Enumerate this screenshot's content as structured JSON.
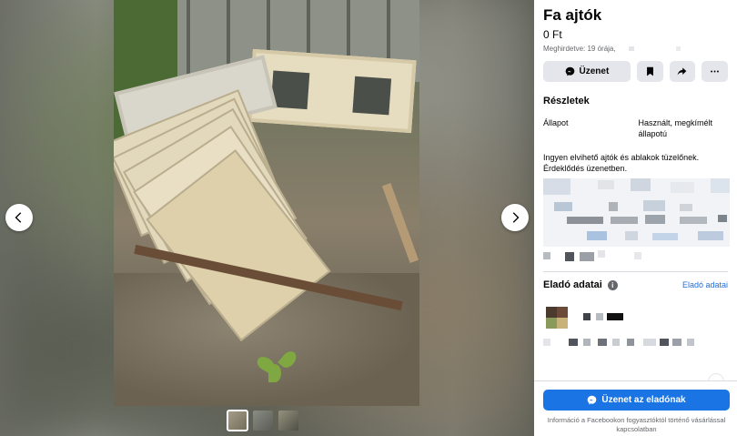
{
  "listing": {
    "title": "Fa ajtók",
    "price": "0 Ft",
    "listed": "Meghirdetve: 19 órája,"
  },
  "actions": {
    "message_label": "Üzenet",
    "message_icon": "messenger-icon",
    "save_icon": "bookmark-icon",
    "share_icon": "share-icon",
    "more_icon": "more-dots-icon"
  },
  "details": {
    "heading": "Részletek",
    "condition_label": "Állapot",
    "condition_value": "Használt, megkímélt állapotú",
    "description": "Ingyen elvihető ajtók és ablakok tüzelőnek. Érdeklődés üzenetben."
  },
  "seller": {
    "heading": "Eladó adatai",
    "link": "Eladó adatai"
  },
  "cta": {
    "label": "Üzenet az eladónak",
    "disclaimer": "Információ a Facebookon fogyasztóktól történő vásárlással kapcsolatban"
  },
  "colors": {
    "primary": "#1b74e4",
    "button_bg": "#e4e6eb",
    "secondary_text": "#65676b",
    "link": "#216fdb"
  }
}
